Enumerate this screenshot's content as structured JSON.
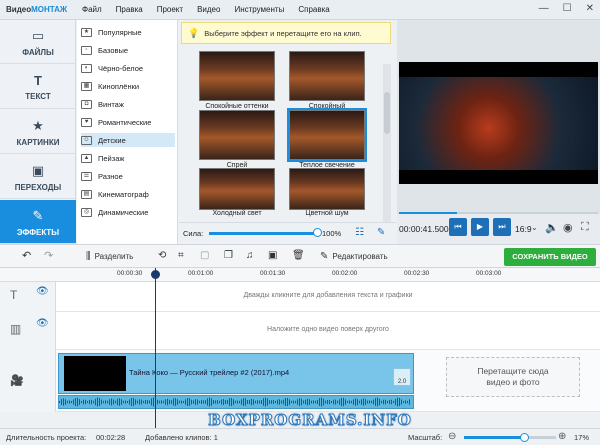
{
  "app": {
    "title_part1": "Видео",
    "title_part2": "МОНТАЖ"
  },
  "menu": [
    "Файл",
    "Правка",
    "Проект",
    "Видео",
    "Инструменты",
    "Справка"
  ],
  "window_controls": [
    "—",
    "☐",
    "✕"
  ],
  "sidebar": {
    "items": [
      {
        "label": "ФАЙЛЫ",
        "icon": "folder-icon",
        "glyph": "▭",
        "active": false
      },
      {
        "label": "ТЕКСТ",
        "icon": "text-icon",
        "glyph": "T",
        "active": false
      },
      {
        "label": "КАРТИНКИ",
        "icon": "star-icon",
        "glyph": "★",
        "active": false
      },
      {
        "label": "ПЕРЕХОДЫ",
        "icon": "transitions-icon",
        "glyph": "▣",
        "active": false
      },
      {
        "label": "ЭФФЕКТЫ",
        "icon": "wand-icon",
        "glyph": "✎",
        "active": true
      }
    ]
  },
  "effects_categories": [
    {
      "label": "Популярные",
      "glyph": "★"
    },
    {
      "label": "Базовые",
      "glyph": "▫"
    },
    {
      "label": "Чёрно-белое",
      "glyph": "◐"
    },
    {
      "label": "Киноплёнки",
      "glyph": "▦"
    },
    {
      "label": "Винтаж",
      "glyph": "◘"
    },
    {
      "label": "Романтические",
      "glyph": "♥"
    },
    {
      "label": "Детские",
      "glyph": "☺",
      "active": true
    },
    {
      "label": "Пейзаж",
      "glyph": "▲"
    },
    {
      "label": "Разное",
      "glyph": "☰"
    },
    {
      "label": "Кинематограф",
      "glyph": "▤"
    },
    {
      "label": "Динамические",
      "glyph": "◎"
    }
  ],
  "gallery": {
    "hint": "Выберите эффект и перетащите его на клип.",
    "thumbnails": [
      {
        "label": "Спокойные оттенки"
      },
      {
        "label": "Спокойный"
      },
      {
        "label": "Спрей"
      },
      {
        "label": "Теплое свечение",
        "selected": true
      },
      {
        "label": "Холодный свет"
      },
      {
        "label": "Цветной шум"
      }
    ],
    "strength_label": "Сила:",
    "strength_value": "100%",
    "strength_fraction": 1.0
  },
  "player": {
    "time": "00:00:41.500",
    "aspect": "16:9",
    "progress_fraction": 0.29
  },
  "toolbar": {
    "split_label": "Разделить",
    "edit_label": "Редактировать",
    "save_label": "СОХРАНИТЬ ВИДЕО"
  },
  "ruler": {
    "ticks": [
      "00:00:30",
      "00:01:00",
      "00:01:30",
      "00:02:00",
      "00:02:30",
      "00:03:00"
    ]
  },
  "tracks": {
    "text_hint": "Дважды кликните для добавления текста и графики",
    "overlay_hint": "Наложите одно видео поверх другого",
    "clip_name": "Тайна Коко — Русский трейлер #2 (2017).mp4",
    "clip_badge": "2.0",
    "drop_zone_line1": "Перетащите сюда",
    "drop_zone_line2": "видео и фото"
  },
  "status": {
    "duration_label": "Длительность проекта:",
    "duration_value": "00:02:28",
    "clips_label": "Добавлено клипов: 1",
    "scale_label": "Масштаб:",
    "scale_value": "17%",
    "scale_fraction": 0.65
  },
  "watermark": "BOXPROGRAMS.INFO",
  "colors": {
    "accent": "#1a8ede",
    "save_green": "#2eae3c",
    "clip_blue": "#79c5e9"
  }
}
